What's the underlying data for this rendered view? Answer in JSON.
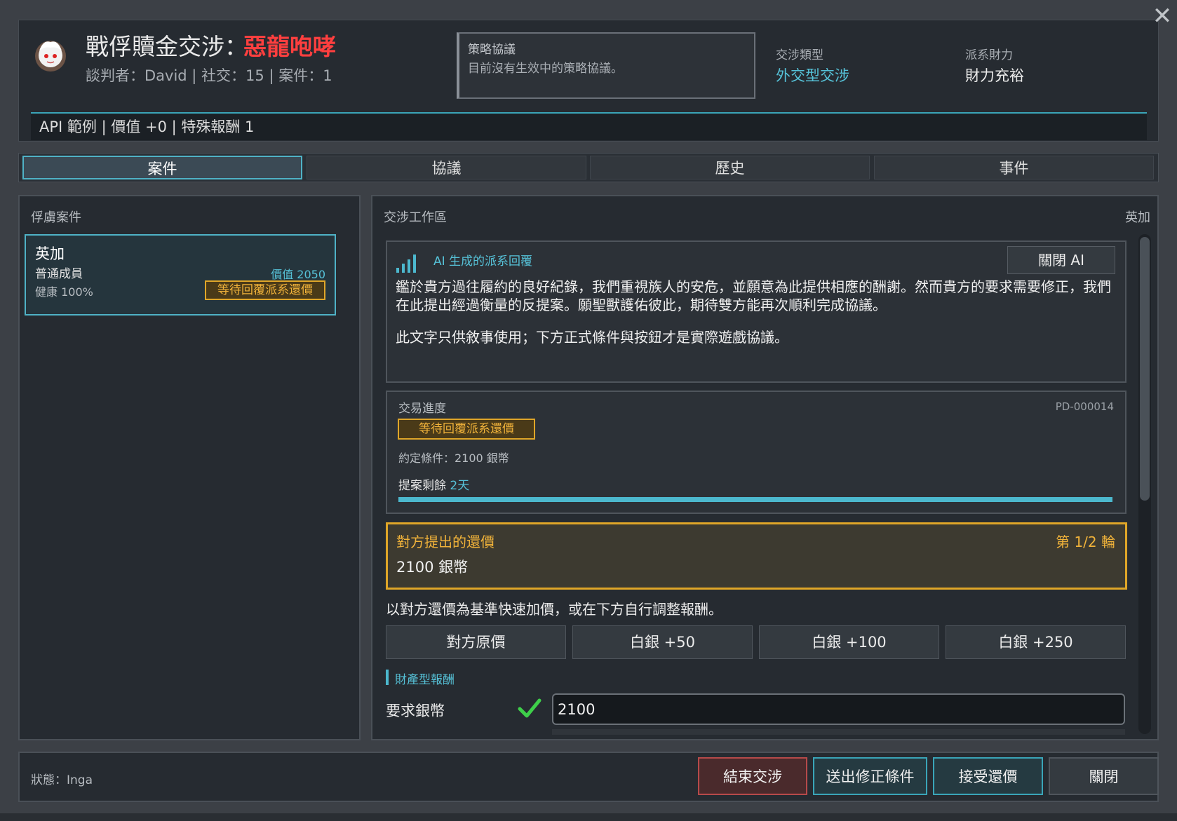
{
  "header": {
    "title_static": "戰俘贖金交涉：",
    "title_accent": "惡龍咆哮",
    "subtitle": "談判者：David | 社交：15 | 案件：1",
    "strategy": {
      "title": "策略協議",
      "text": "目前沒有生效中的策略協議。"
    },
    "negotiation_type": {
      "label": "交涉類型",
      "value": "外交型交涉"
    },
    "faction_finance": {
      "label": "派系財力",
      "value": "財力充裕"
    },
    "info_bar": "API 範例 | 價值 +0 | 特殊報酬 1"
  },
  "tabs": [
    {
      "label": "案件",
      "active": true
    },
    {
      "label": "協議",
      "active": false
    },
    {
      "label": "歷史",
      "active": false
    },
    {
      "label": "事件",
      "active": false
    }
  ],
  "left_panel": {
    "title": "俘虜案件",
    "prisoner": {
      "name": "英加",
      "rank": "普通成員",
      "value_label": "價值 2050",
      "health": "健康 100%",
      "status": "等待回覆派系還價"
    }
  },
  "workspace": {
    "title": "交涉工作區",
    "target": "英加",
    "ai": {
      "label": "AI 生成的派系回覆",
      "close_button": "關閉 AI",
      "text1": "鑑於貴方過往履約的良好紀錄，我們重視族人的安危，並願意為此提供相應的酬謝。然而貴方的要求需要修正，我們在此提出經過衡量的反提案。願聖獸護佑彼此，期待雙方能再次順利完成協議。",
      "text2": "此文字只供敘事使用；下方正式條件與按鈕才是實際遊戲協議。"
    },
    "trade": {
      "title": "交易進度",
      "id": "PD-000014",
      "status": "等待回覆派系還價",
      "terms": "約定條件：2100 銀幣",
      "remaining_prefix": "提案剩餘 ",
      "remaining_days": "2天",
      "progress": 1.0
    },
    "counter": {
      "title": "對方提出的還價",
      "round": "第 1/2 輪",
      "amount": "2100 銀幣"
    },
    "quick_hint": "以對方還價為基準快速加價，或在下方自行調整報酬。",
    "quick_buttons": [
      "對方原價",
      "白銀 +50",
      "白銀 +100",
      "白銀 +250"
    ],
    "section_title": "財產型報酬",
    "silver": {
      "label": "要求銀幣",
      "value": "2100"
    }
  },
  "footer": {
    "status": "狀態：Inga",
    "end_button": "結束交涉",
    "send_button": "送出修正條件",
    "accept_button": "接受還價",
    "close_button": "關閉"
  },
  "colors": {
    "accent": "#4fb2c6",
    "warning": "#e0a628",
    "danger": "#ff3f3f"
  },
  "icons": {
    "avatar": "avatar-icon",
    "close": "close-icon",
    "signal": "signal-icon",
    "check": "check-icon"
  }
}
